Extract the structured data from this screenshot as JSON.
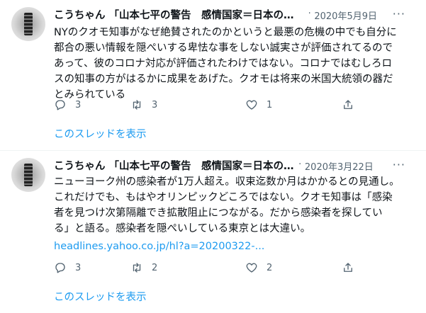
{
  "tweets": [
    {
      "name": "こうちゃん 「山本七平の警告　感情国家＝日本の没…",
      "dot": "·",
      "date": "2020年5月9日",
      "more": "···",
      "body": "NYのクオモ知事がなぜ絶賛されたのかというと最悪の危機の中でも自分に\n都合の悪い情報を隠ぺいする卑怯な事をしない誠実さが評価されてるので\nあって、彼のコロナ対応が評価されたわけではない。コロナではむしろロ\nスの知事の方がはるかに成果をあげた。クオモは将来の米国大統領の器だ\nとみられている",
      "replies": "3",
      "retweets": "3",
      "likes": "1",
      "thread": "このスレッドを表示"
    },
    {
      "name": "こうちゃん 「山本七平の警告　感情国家＝日本の…",
      "dot": "·",
      "date": "2020年3月22日",
      "more": "···",
      "body": "ニューヨーク州の感染者が1万人超え。収束迄数か月はかかるとの見通し。\nこれだけでも、もはやオリンピックどころではない。クオモ知事は「感染\n者を見つけ次第隔離でき拡散阻止につながる。だから感染者を探してい\nる」と語る。感染者を隠ぺいしている東京とは大違い。",
      "link": "headlines.yahoo.co.jp/hl?a=20200322-...",
      "replies": "3",
      "retweets": "2",
      "likes": "2",
      "thread": "このスレッドを表示"
    }
  ]
}
